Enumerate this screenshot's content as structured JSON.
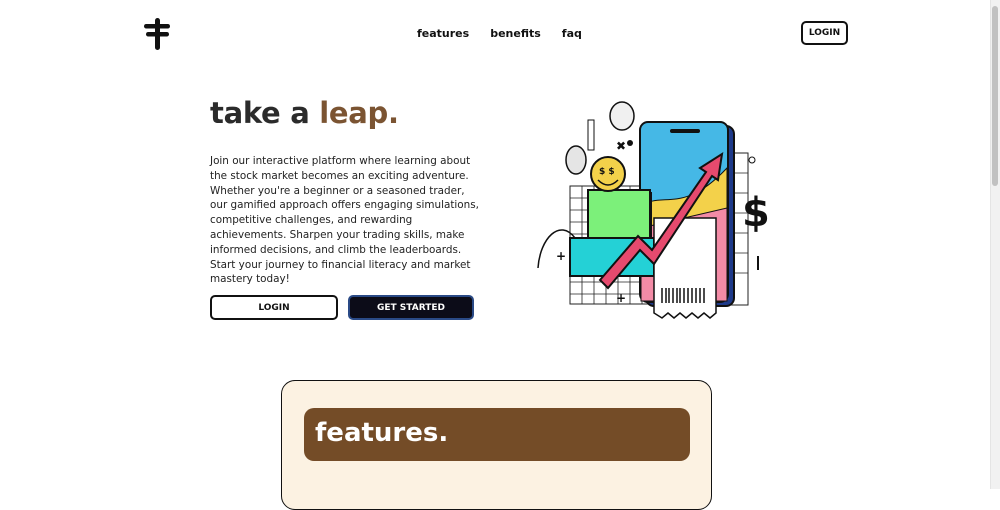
{
  "header": {
    "logo_icon": "three-bar-cross-logo",
    "nav": [
      "features",
      "benefits",
      "faq"
    ],
    "login_label": "LOGIN"
  },
  "hero": {
    "title_part1": "take a ",
    "title_accent": "leap.",
    "description": "Join our interactive platform where learning about the stock market becomes an exciting adventure. Whether you're a beginner or a seasoned trader, our gamified approach offers engaging simulations, competitive challenges, and rewarding achievements. Sharpen your trading skills, make informed decisions, and climb the leaderboards. Start your journey to financial literacy and market mastery today!",
    "login_label": "LOGIN",
    "get_started_label": "GET STARTED",
    "illustration_icon": "stock-market-phone-illustration",
    "illustration_symbol": "$"
  },
  "features": {
    "heading": "features."
  },
  "colors": {
    "accent_brown": "#7b5432",
    "banner_brown": "#744c27",
    "card_cream": "#fcf2e2",
    "dark_button": "#0c0c18",
    "button_border_blue": "#2a4a86"
  }
}
